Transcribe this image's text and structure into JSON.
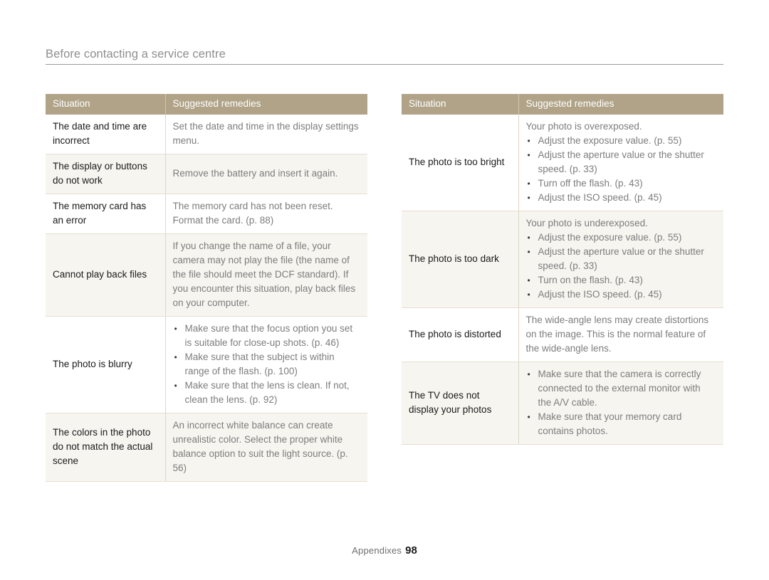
{
  "header": {
    "title": "Before contacting a service centre"
  },
  "footer": {
    "section_label": "Appendixes",
    "page_number": "98"
  },
  "colors": {
    "table_header_bg": "#b0a388",
    "table_header_text": "#ffffff",
    "row_shade_bg": "#f7f5f0",
    "row_plain_bg": "#ffffff",
    "body_text": "#7d7d7d",
    "situation_text": "#1a1a1a",
    "rule": "#9a9a9a",
    "running_head_text": "#8e8e8e"
  },
  "tables": [
    {
      "id": "left-table",
      "columns": [
        "Situation",
        "Suggested remedies"
      ],
      "rows": [
        {
          "situation": "The date and time are incorrect",
          "lead": "Set the date and time in the display settings menu.",
          "bullets": []
        },
        {
          "situation": "The display or buttons do not work",
          "lead": "Remove the battery and insert it again.",
          "bullets": []
        },
        {
          "situation": "The memory card has an error",
          "lead": "The memory card has not been reset. Format the card. (p. 88)",
          "bullets": []
        },
        {
          "situation": "Cannot play back files",
          "lead": "If you change the name of a file, your camera may not play the file (the name of the file should meet the DCF standard). If you encounter this situation, play back files on your computer.",
          "bullets": []
        },
        {
          "situation": "The photo is blurry",
          "lead": "",
          "bullets": [
            "Make sure that the focus option you set is suitable for close-up shots. (p. 46)",
            "Make sure that the subject is within range of the flash. (p. 100)",
            "Make sure that the lens is clean. If not, clean the lens. (p. 92)"
          ]
        },
        {
          "situation": "The colors in the photo do not match the actual scene",
          "lead": "An incorrect white balance can create unrealistic color. Select the proper white balance option to suit the light source. (p. 56)",
          "bullets": []
        }
      ]
    },
    {
      "id": "right-table",
      "columns": [
        "Situation",
        "Suggested remedies"
      ],
      "rows": [
        {
          "situation": "The photo is too bright",
          "lead": "Your photo is overexposed.",
          "bullets": [
            "Adjust the exposure value. (p. 55)",
            "Adjust the aperture value or the shutter speed. (p. 33)",
            "Turn off the flash. (p. 43)",
            "Adjust the ISO speed. (p. 45)"
          ]
        },
        {
          "situation": "The photo is too dark",
          "lead": "Your photo is underexposed.",
          "bullets": [
            "Adjust the exposure value. (p. 55)",
            "Adjust the aperture value or the shutter speed. (p. 33)",
            "Turn on the flash. (p. 43)",
            "Adjust the ISO speed. (p. 45)"
          ]
        },
        {
          "situation": "The photo is distorted",
          "lead": "The wide-angle lens may create distortions on the image. This is the normal feature of the wide-angle lens.",
          "bullets": []
        },
        {
          "situation": "The TV does not display your photos",
          "lead": "",
          "bullets": [
            "Make sure that the camera is correctly connected to the external monitor with the A/V cable.",
            "Make sure that your memory card contains photos."
          ]
        }
      ]
    }
  ]
}
